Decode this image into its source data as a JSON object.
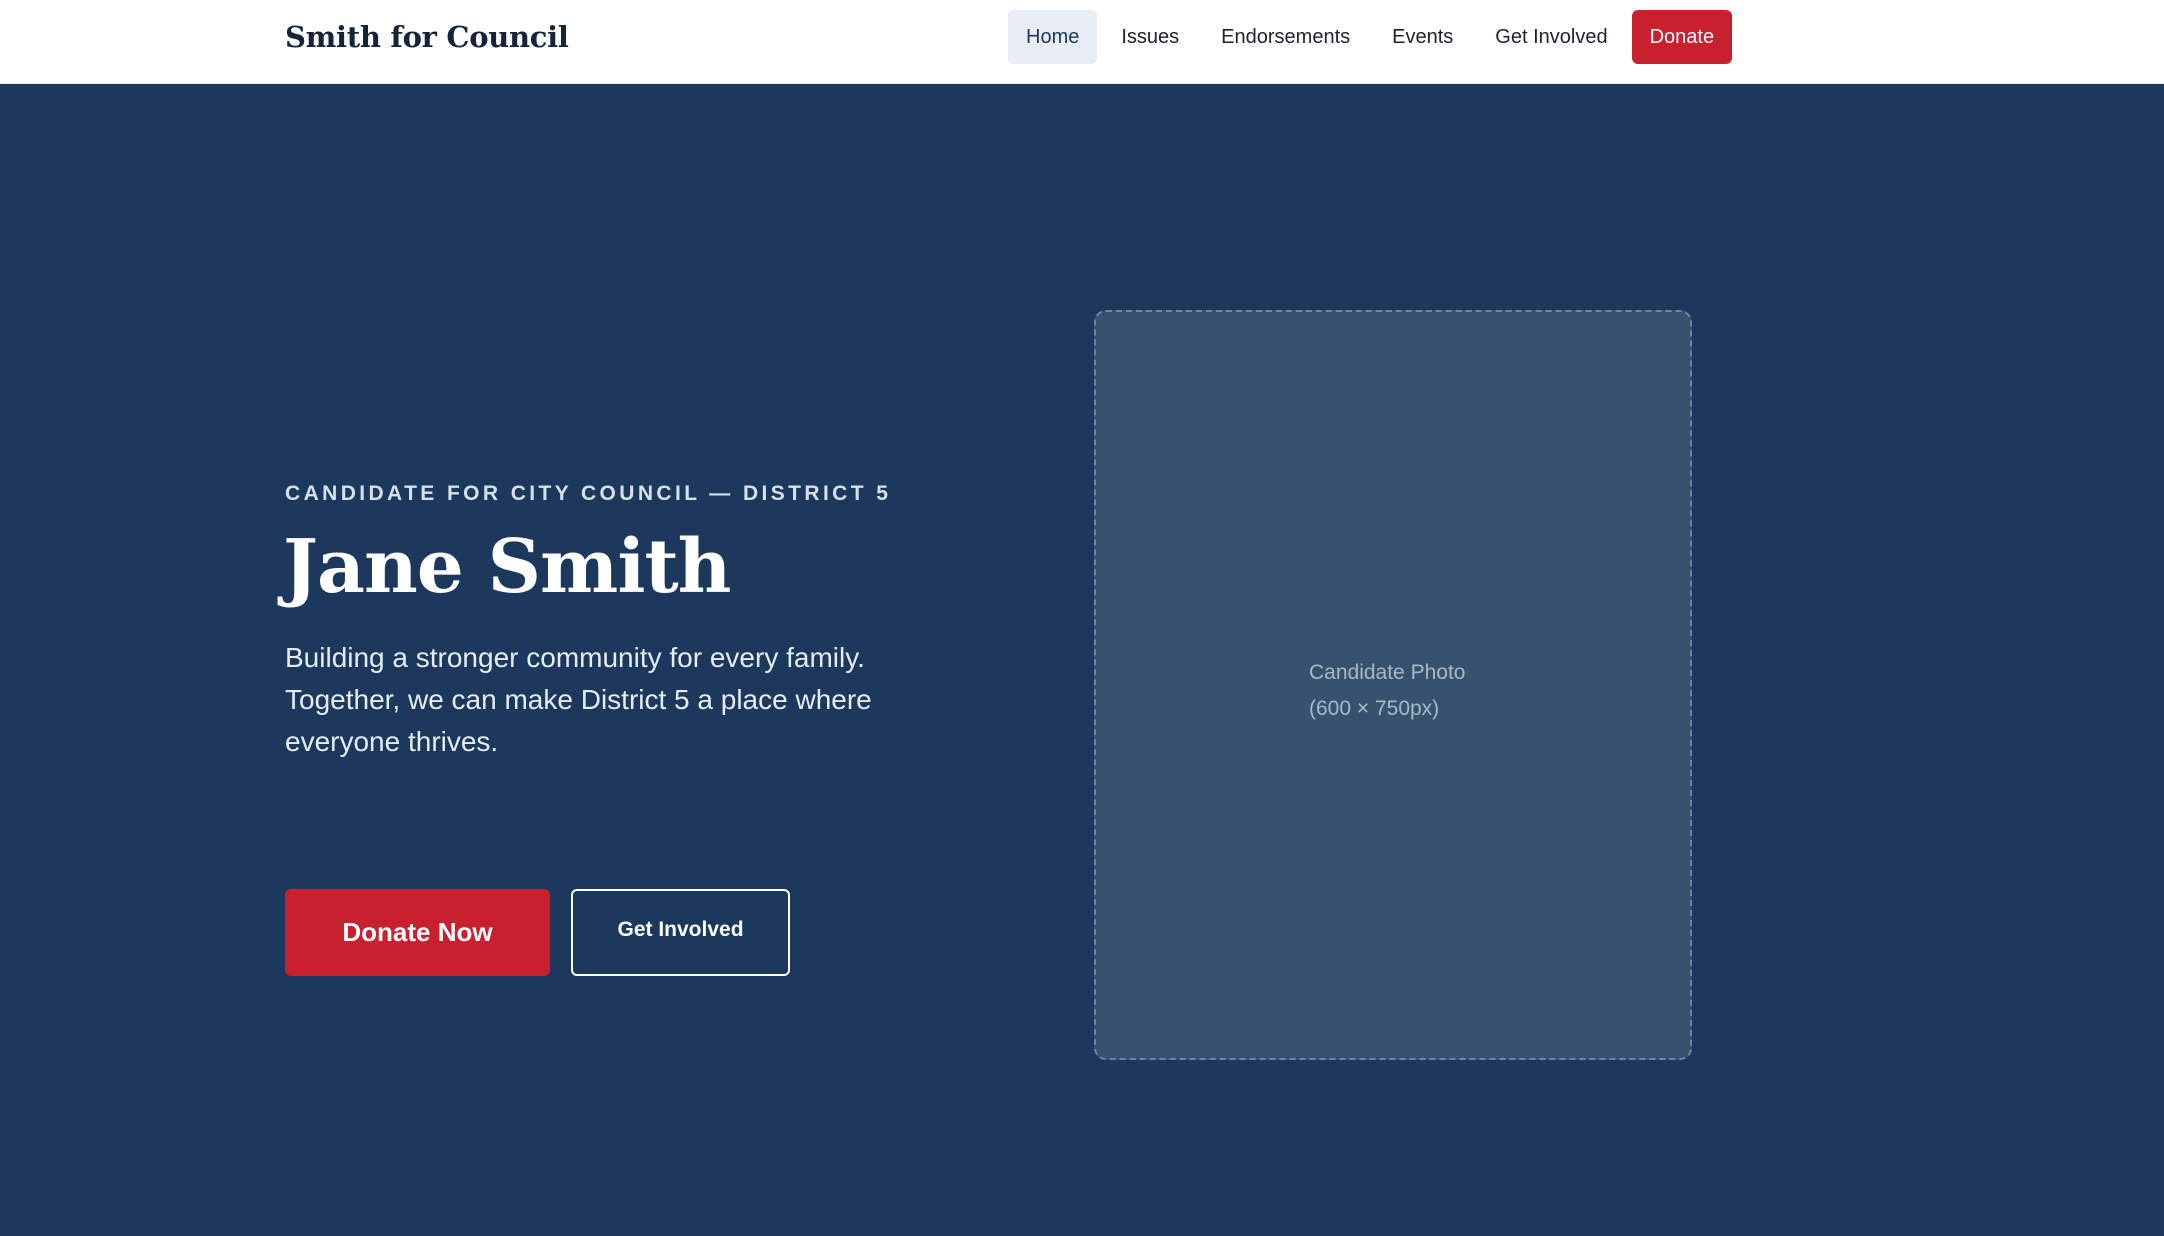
{
  "header": {
    "brand": "Smith for Council",
    "nav": [
      {
        "label": "Home",
        "active": true
      },
      {
        "label": "Issues",
        "active": false
      },
      {
        "label": "Endorsements",
        "active": false
      },
      {
        "label": "Events",
        "active": false
      },
      {
        "label": "Get Involved",
        "active": false
      }
    ],
    "donate_label": "Donate"
  },
  "hero": {
    "eyebrow": "CANDIDATE FOR CITY COUNCIL — DISTRICT 5",
    "name": "Jane Smith",
    "tagline": "Building a stronger community for every family. Together, we can make District 5 a place where everyone thrives.",
    "primary_cta": "Donate Now",
    "secondary_cta": "Get Involved",
    "photo_placeholder": {
      "line1": "Candidate Photo",
      "line2": "(600 × 750px)"
    }
  },
  "colors": {
    "brand_navy": "#1c385c",
    "accent_red": "#c8202f",
    "white": "#ffffff"
  }
}
